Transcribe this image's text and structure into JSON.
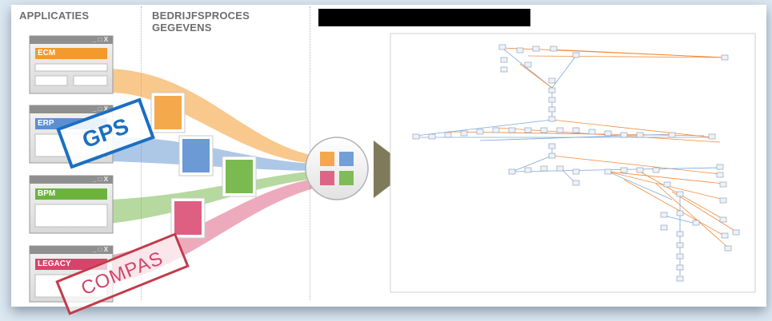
{
  "headers": {
    "applications": "APPLICATIES",
    "process_data_line1": "BEDRIJFSPROCES",
    "process_data_line2": "GEGEVENS"
  },
  "apps": [
    {
      "label": "ECM",
      "controls": "_ □ X",
      "color": "#f29a2e"
    },
    {
      "label": "ERP",
      "controls": "_ □ X",
      "color": "#5b8fd0"
    },
    {
      "label": "BPM",
      "controls": "_ □ X",
      "color": "#6cb33e"
    },
    {
      "label": "LEGACY",
      "controls": "_ □ X",
      "color": "#d8436c"
    }
  ],
  "stamps": {
    "gps": "GPS",
    "compas": "COMPAS"
  },
  "colors": {
    "orange": "#f29a2e",
    "blue": "#5b8fd0",
    "green": "#6cb33e",
    "pink": "#d8436c",
    "arrow": "#7f7a5c",
    "edge_orange": "#f08a3c",
    "edge_blue": "#7da6d8"
  }
}
